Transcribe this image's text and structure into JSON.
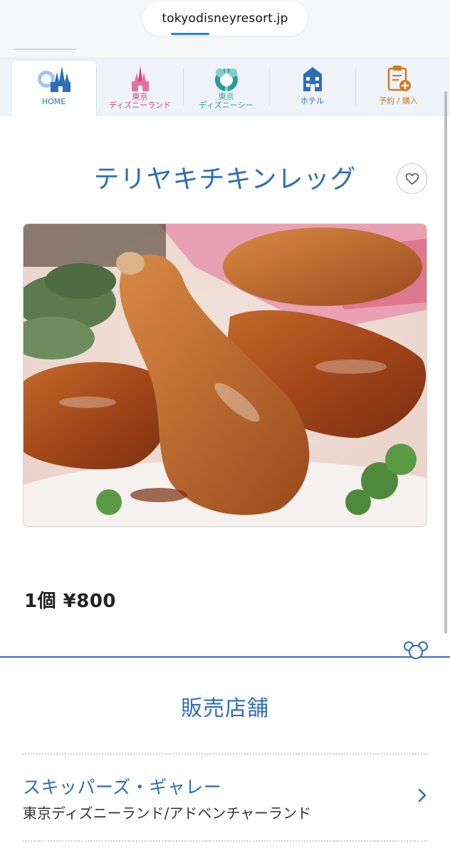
{
  "browser": {
    "url": "tokyodisneyresort.jp"
  },
  "nav": {
    "tabs": [
      {
        "label": "HOME",
        "icon": "home-castle-icon",
        "color": "#2f6db5"
      },
      {
        "label": "東京\nディズニーランド",
        "icon": "land-castle-icon",
        "color": "#d6417a"
      },
      {
        "label": "東京\nディズニーシー",
        "icon": "sea-globe-icon",
        "color": "#2a9d9a"
      },
      {
        "label": "ホテル",
        "icon": "hotel-icon",
        "color": "#2f6db5"
      },
      {
        "label": "予約 / 購入",
        "icon": "reservation-icon",
        "color": "#d07a1c"
      }
    ]
  },
  "product": {
    "title": "テリヤキチキンレッグ",
    "price": "1個 ¥800"
  },
  "section": {
    "title": "販売店舗"
  },
  "stores": [
    {
      "name": "スキッパーズ・ギャレー",
      "location": "東京ディズニーランド/アドベンチャーランド"
    }
  ],
  "colors": {
    "accent": "#2f6db5",
    "land": "#d6417a",
    "sea": "#2a9d9a",
    "booking": "#d07a1c"
  }
}
